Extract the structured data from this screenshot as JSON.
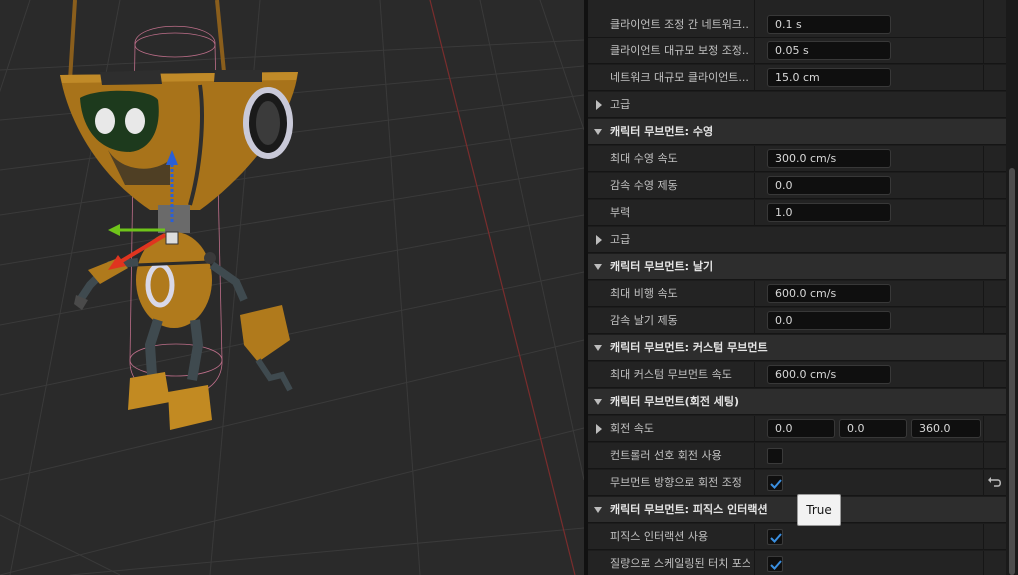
{
  "details": {
    "rows": [
      {
        "name": "클라이언트 조정 간 네트워크...",
        "value": "0.1 s"
      },
      {
        "name": "클라이언트 대규모 보정 조정...",
        "value": "0.05 s"
      },
      {
        "name": "네트워크 대규모 클라이언트...",
        "value": "15.0 cm"
      },
      {
        "name": "고급"
      },
      {
        "name": "캐릭터 무브먼트: 수영"
      },
      {
        "name": "최대 수영 속도",
        "value": "300.0 cm/s"
      },
      {
        "name": "감속 수영 제동",
        "value": "0.0"
      },
      {
        "name": "부력",
        "value": "1.0"
      },
      {
        "name": "고급"
      },
      {
        "name": "캐릭터 무브먼트: 날기"
      },
      {
        "name": "최대 비행 속도",
        "value": "600.0 cm/s"
      },
      {
        "name": "감속 날기 제동",
        "value": "0.0"
      },
      {
        "name": "캐릭터 무브먼트: 커스텀 무브먼트"
      },
      {
        "name": "최대 커스텀 무브먼트 속도",
        "value": "600.0 cm/s"
      },
      {
        "name": "캐릭터 무브먼트(회전 세팅)"
      },
      {
        "name": "회전 속도",
        "values": [
          "0.0",
          "0.0",
          "360.0"
        ]
      },
      {
        "name": "컨트롤러 선호 회전 사용",
        "checked": false
      },
      {
        "name": "무브먼트 방향으로 회전 조정",
        "checked": true
      },
      {
        "name": "캐릭터 무브먼트: 피직스 인터랙션"
      },
      {
        "name": "피직스 인터랙션 사용",
        "checked": true
      },
      {
        "name": "질량으로 스케일링된 터치 포스",
        "checked": true
      }
    ],
    "tooltip": "True"
  },
  "colors": {
    "checkmark": "#3a8fe0",
    "robot_body": "#b07a1c",
    "gizmo_x": "#e0341f",
    "gizmo_y": "#6fc41a",
    "gizmo_z": "#2a5fd6",
    "wireframe": "#d77a9a"
  },
  "icons": [
    "reset-arrow-icon",
    "expand-arrow-icon",
    "collapse-arrow-icon",
    "checkmark-icon"
  ]
}
